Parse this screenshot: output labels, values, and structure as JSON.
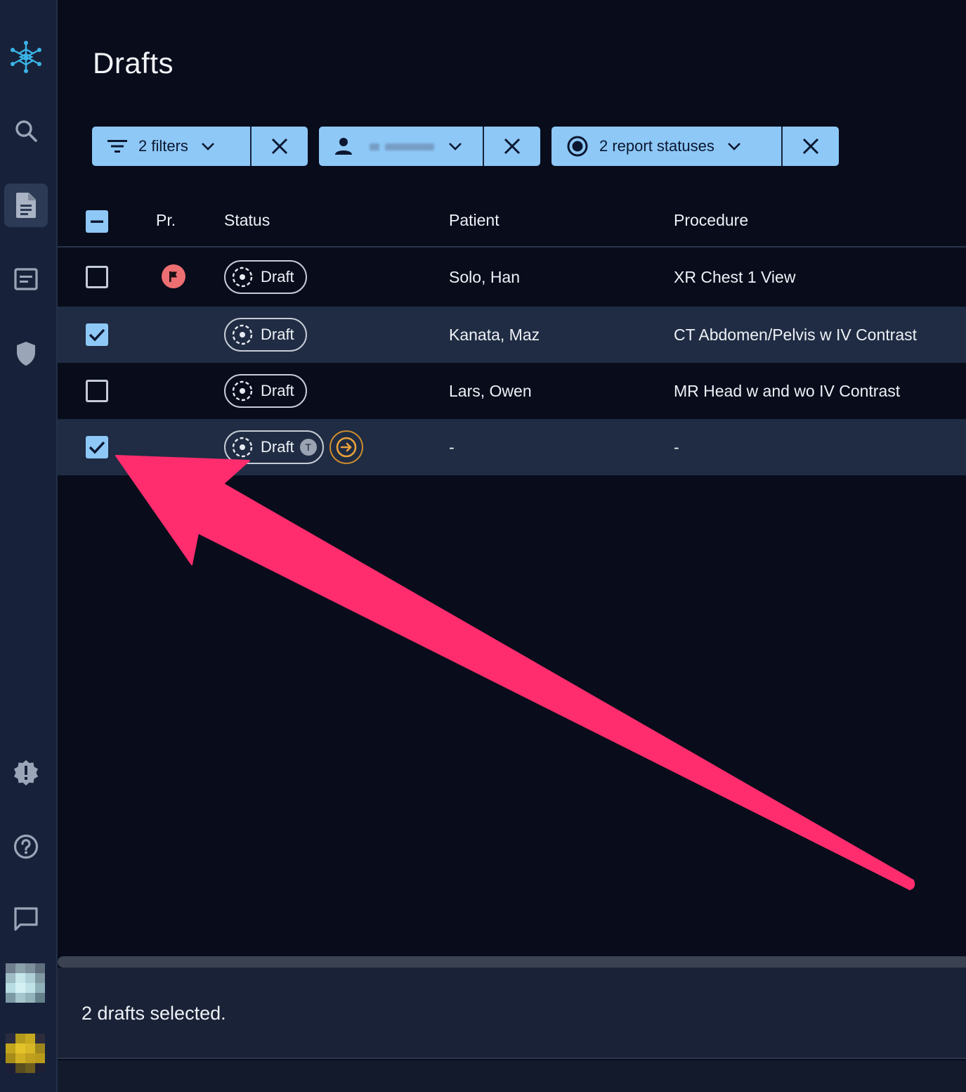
{
  "page": {
    "title": "Drafts"
  },
  "sidebar": {
    "items": [
      {
        "name": "logo",
        "icon": "network-logo-icon"
      },
      {
        "name": "search",
        "icon": "search-icon"
      },
      {
        "name": "drafts",
        "icon": "document-icon",
        "active": true
      },
      {
        "name": "templates",
        "icon": "form-icon"
      },
      {
        "name": "security",
        "icon": "shield-icon"
      },
      {
        "name": "alerts",
        "icon": "alert-badge-icon"
      },
      {
        "name": "help",
        "icon": "help-circle-icon"
      },
      {
        "name": "feedback",
        "icon": "chat-icon"
      }
    ]
  },
  "filters": {
    "general": {
      "label": "2 filters",
      "icon": "filter-lines-icon"
    },
    "user": {
      "label": "",
      "icon": "person-icon"
    },
    "status": {
      "label": "2 report statuses",
      "icon": "radio-icon"
    }
  },
  "table": {
    "columns": {
      "priority": "Pr.",
      "status": "Status",
      "patient": "Patient",
      "procedure": "Procedure"
    },
    "rows": [
      {
        "selected": false,
        "priority_flag": true,
        "status": "Draft",
        "template_badge": "",
        "assign": false,
        "patient": "Solo, Han",
        "procedure": "XR Chest 1 View"
      },
      {
        "selected": true,
        "priority_flag": false,
        "status": "Draft",
        "template_badge": "",
        "assign": false,
        "patient": "Kanata, Maz",
        "procedure": "CT Abdomen/Pelvis w IV Contrast"
      },
      {
        "selected": false,
        "priority_flag": false,
        "status": "Draft",
        "template_badge": "",
        "assign": false,
        "patient": "Lars, Owen",
        "procedure": "MR Head w and wo IV Contrast"
      },
      {
        "selected": true,
        "priority_flag": false,
        "status": "Draft",
        "template_badge": "T",
        "assign": true,
        "patient": "-",
        "procedure": "-"
      }
    ]
  },
  "footer": {
    "selection_text": "2 drafts selected."
  },
  "colors": {
    "accent": "#8ec8f7",
    "annotation_arrow": "#ff2d6e",
    "flag": "#ee6f72",
    "assign": "#e8a23a"
  }
}
